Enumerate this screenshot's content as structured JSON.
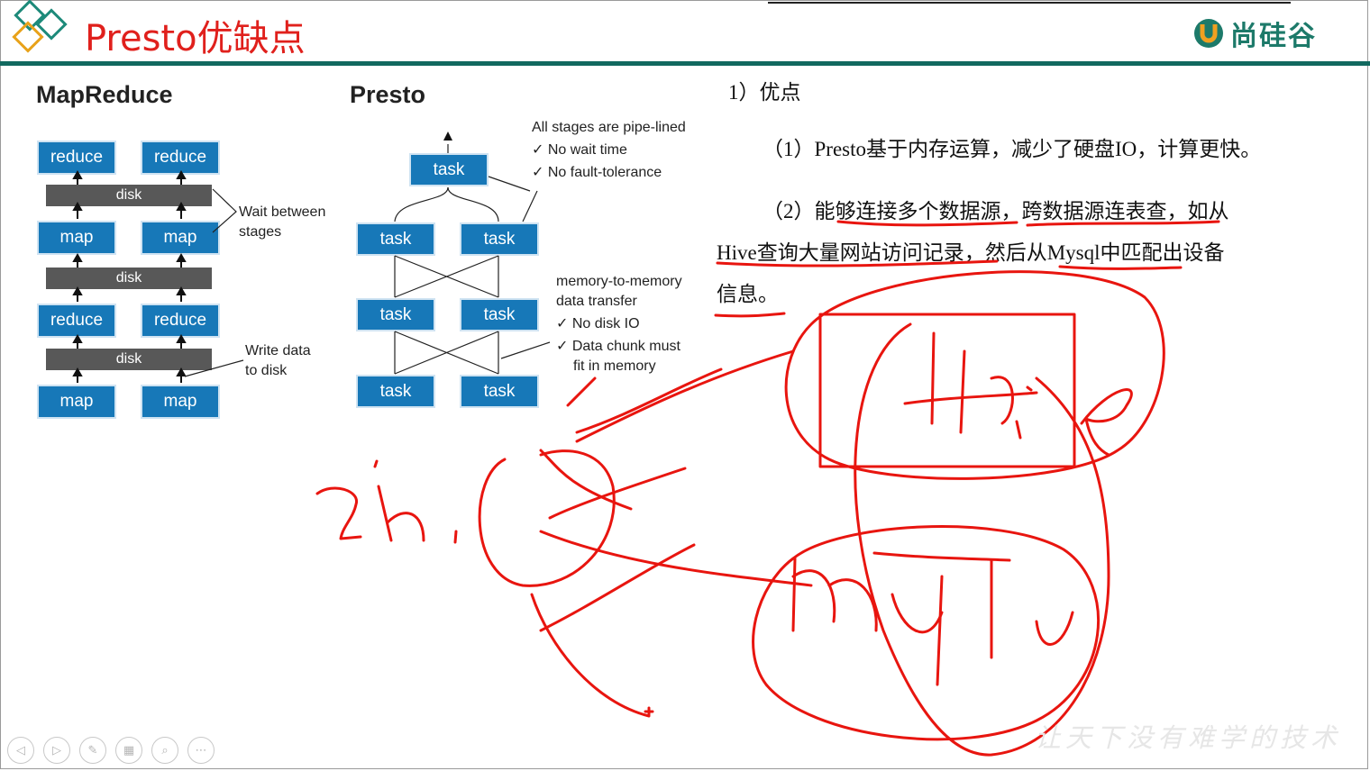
{
  "header": {
    "title": "Presto优缺点",
    "brand_name": "尚硅谷",
    "brand_mark": "U",
    "accent_color": "#e0201c",
    "rule_color": "#12695f"
  },
  "mapreduce": {
    "heading": "MapReduce",
    "rows": [
      {
        "kind": "reduce",
        "labels": [
          "reduce",
          "reduce"
        ]
      },
      {
        "kind": "disk",
        "labels": [
          "disk"
        ]
      },
      {
        "kind": "map",
        "labels": [
          "map",
          "map"
        ]
      },
      {
        "kind": "disk",
        "labels": [
          "disk"
        ]
      },
      {
        "kind": "reduce",
        "labels": [
          "reduce",
          "reduce"
        ]
      },
      {
        "kind": "disk",
        "labels": [
          "disk"
        ]
      },
      {
        "kind": "map",
        "labels": [
          "map",
          "map"
        ]
      }
    ],
    "note_wait": [
      "Wait between",
      "stages"
    ],
    "note_write": [
      "Write data",
      "to disk"
    ]
  },
  "presto": {
    "heading": "Presto",
    "task_label": "task",
    "note_pipeline": [
      "All stages are pipe-lined",
      "✓ No wait time",
      "✓ No fault-tolerance"
    ],
    "note_memory": [
      "memory-to-memory",
      "data transfer",
      "✓ No disk IO",
      "✓ Data chunk must",
      "fit in memory"
    ]
  },
  "content": {
    "heading": "1）优点",
    "para1": "（1）Presto基于内存运算，减少了硬盘IO，计算更快。",
    "para2_line1": "（2）能够连接多个数据源，跨数据源连表查，如从",
    "para2_line2": "Hive查询大量网站访问记录，然后从Mysql中匹配出设备",
    "para2_line3": "信息。"
  },
  "annotation": {
    "ink_color": "#e8150f",
    "scribbles": [
      "zh",
      "Hive",
      "mysql"
    ]
  },
  "nav": {
    "buttons": [
      {
        "icon": "prev-icon",
        "glyph": "◁"
      },
      {
        "icon": "next-icon",
        "glyph": "▷"
      },
      {
        "icon": "pen-icon",
        "glyph": "✎"
      },
      {
        "icon": "slides-icon",
        "glyph": "▦"
      },
      {
        "icon": "zoom-icon",
        "glyph": "⌕"
      },
      {
        "icon": "more-icon",
        "glyph": "⋯"
      }
    ]
  },
  "footer": {
    "slogan": "让天下没有难学的技术"
  }
}
